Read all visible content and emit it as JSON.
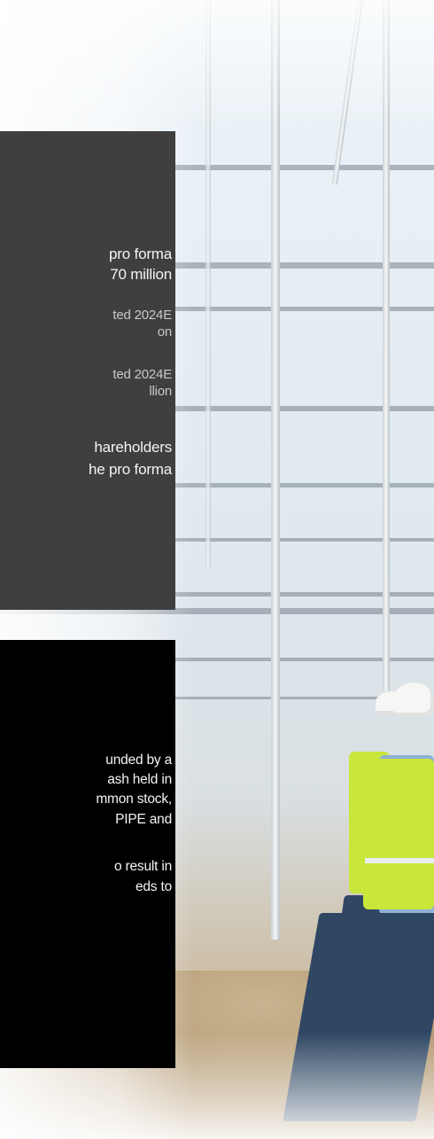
{
  "gray_panel": {
    "highlight_lines": [
      "pro forma",
      "70 million"
    ],
    "estimate_1": [
      "ted 2024E",
      "on"
    ],
    "estimate_2": [
      "ted 2024E",
      "llion"
    ],
    "shareholders": [
      "hareholders",
      "he pro forma"
    ]
  },
  "black_panel": {
    "paragraph_1": [
      "unded by a",
      "ash held in",
      "mmon stock,",
      "PIPE and"
    ],
    "paragraph_2": [
      "o result in",
      "eds to"
    ]
  },
  "colors": {
    "gray_panel_bg": "#3f3f3f",
    "black_panel_bg": "#000000",
    "vest_hi_vis": "#c9e63a"
  }
}
